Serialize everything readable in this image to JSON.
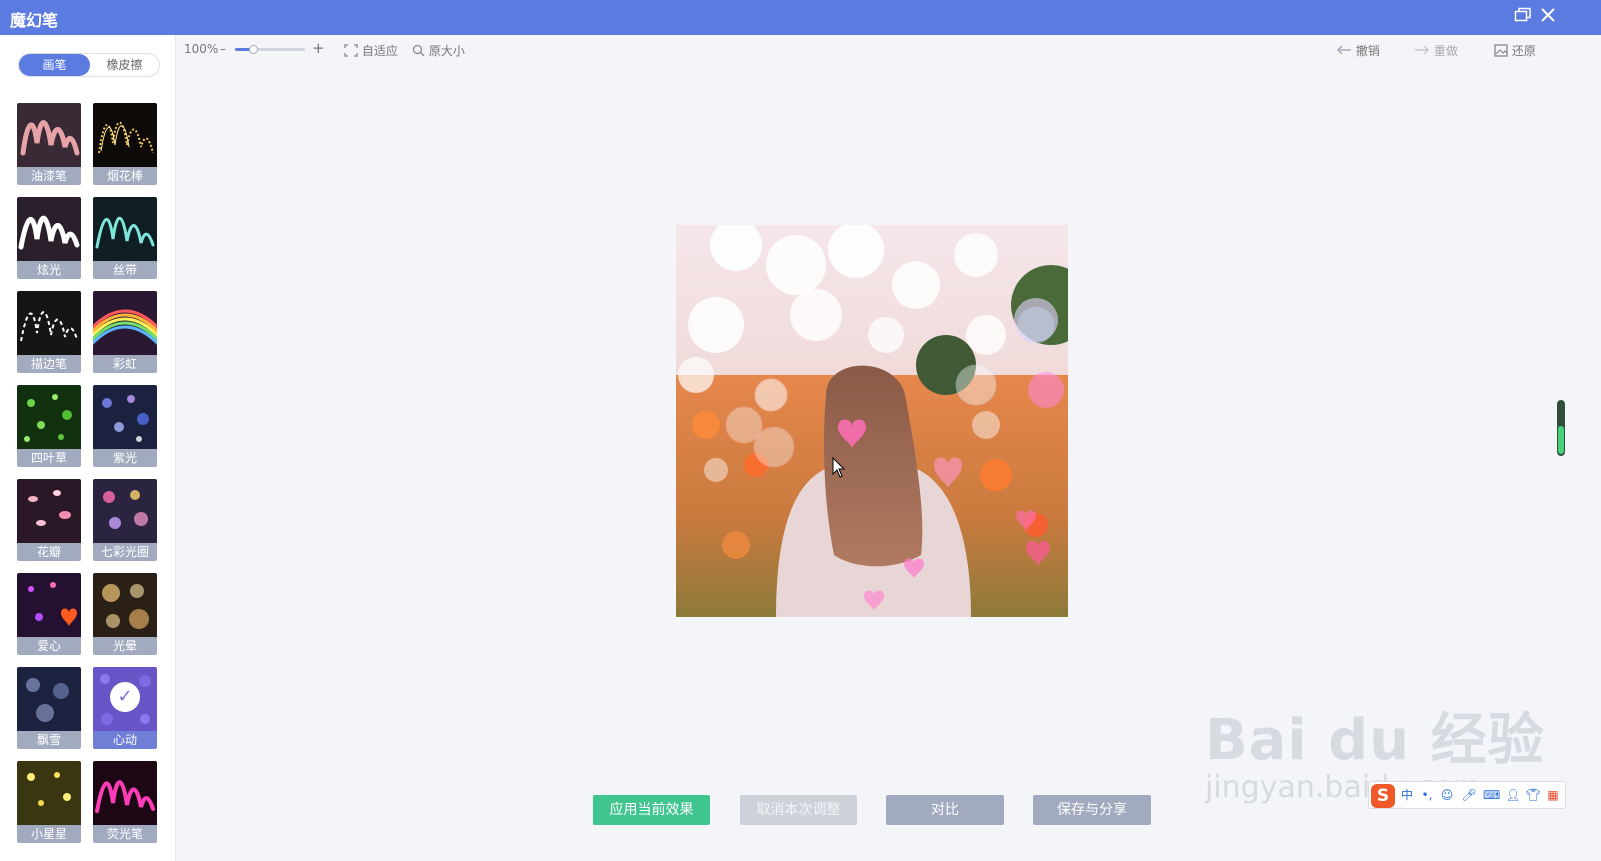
{
  "app": {
    "title": "魔幻笔"
  },
  "mode": {
    "brush_label": "画笔",
    "eraser_label": "橡皮擦"
  },
  "brushes": [
    {
      "label": "油漆笔",
      "icon": "paint-squiggle-icon"
    },
    {
      "label": "烟花棒",
      "icon": "sparkler-squiggle-icon"
    },
    {
      "label": "炫光",
      "icon": "glow-squiggle-icon"
    },
    {
      "label": "丝带",
      "icon": "ribbon-squiggle-icon"
    },
    {
      "label": "描边笔",
      "icon": "stroke-squiggle-icon"
    },
    {
      "label": "彩虹",
      "icon": "rainbow-icon"
    },
    {
      "label": "四叶草",
      "icon": "clover-icon"
    },
    {
      "label": "紫光",
      "icon": "purple-bokeh-icon"
    },
    {
      "label": "花瓣",
      "icon": "petals-icon"
    },
    {
      "label": "七彩光圈",
      "icon": "colorful-rings-icon"
    },
    {
      "label": "爱心",
      "icon": "hearts-icon"
    },
    {
      "label": "光晕",
      "icon": "halo-icon"
    },
    {
      "label": "飘雪",
      "icon": "snow-icon"
    },
    {
      "label": "心动",
      "icon": "heartbeat-icon",
      "selected": true
    },
    {
      "label": "小星星",
      "icon": "stars-icon"
    },
    {
      "label": "荧光笔",
      "icon": "neon-squiggle-icon"
    }
  ],
  "toolbar": {
    "zoom": "100%",
    "zoom_minus": "–",
    "zoom_plus": "+",
    "zoom_level": 0.2,
    "fit_label": "自适应",
    "original_size_label": "原大小",
    "undo_label": "撤销",
    "redo_label": "重做",
    "restore_label": "还原"
  },
  "buttons": {
    "apply": "应用当前效果",
    "cancel": "取消本次调整",
    "compare": "对比",
    "save_share": "保存与分享"
  },
  "watermark": {
    "main": "Bai du 经验",
    "sub": "jingyan.baidu.com"
  },
  "ime": {
    "logo": "S",
    "lang": "中"
  },
  "colors": {
    "accent": "#5b7be0",
    "apply": "#41c58f",
    "neutral": "#a2aac0"
  }
}
